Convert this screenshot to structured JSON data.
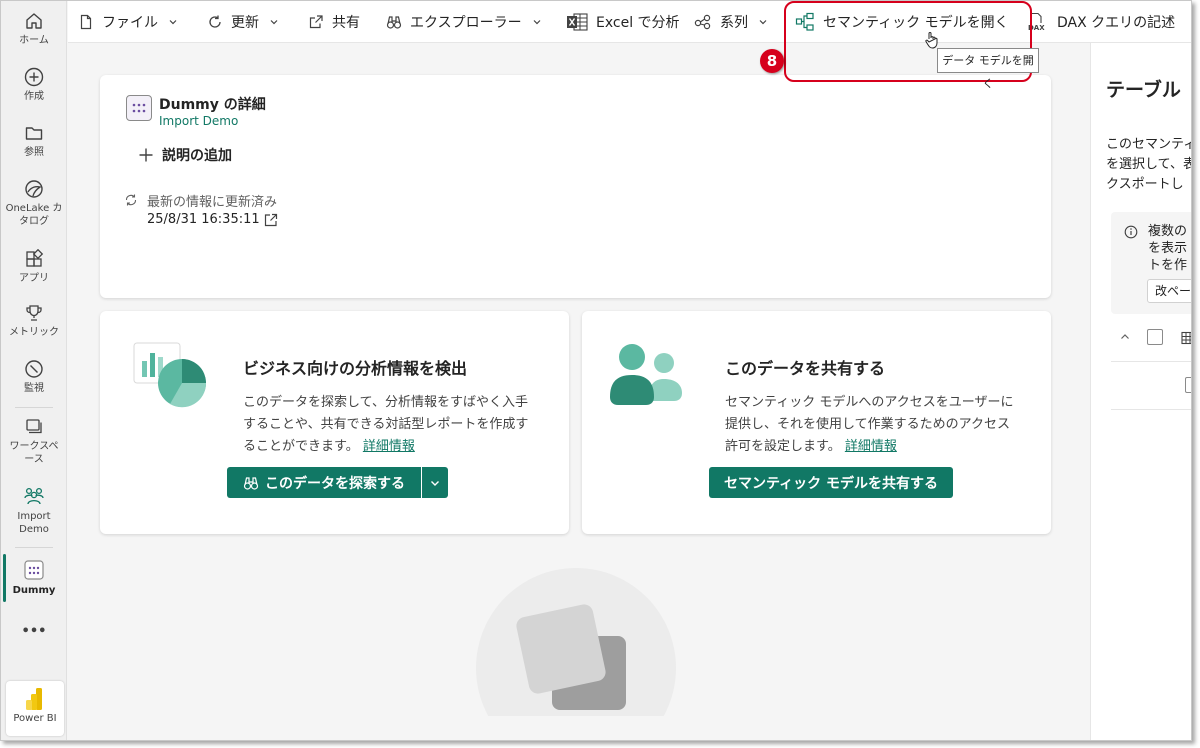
{
  "nav": {
    "home": "ホーム",
    "create": "作成",
    "browse": "参照",
    "onelake": "OneLake カタログ",
    "apps": "アプリ",
    "metrics": "メトリック",
    "monitor": "監視",
    "workspaces": "ワークスペース",
    "import_demo": "Import Demo",
    "dummy": "Dummy",
    "more": "•••",
    "powerbi": "Power BI"
  },
  "toolbar": {
    "file": "ファイル",
    "refresh": "更新",
    "share": "共有",
    "explorer": "エクスプローラー",
    "excel": "Excel で分析",
    "lineage": "系列",
    "open_model": "セマンティック モデルを開く",
    "dax": "DAX クエリの記述"
  },
  "annotation": {
    "step": "8",
    "tooltip": "データ モデルを開く"
  },
  "details": {
    "title": "Dummy の詳細",
    "workspace": "Import Demo",
    "add_description": "説明の追加",
    "refresh_status": "最新の情報に更新済み",
    "refresh_time": "25/8/31 16:35:11"
  },
  "discover": {
    "title": "ビジネス向けの分析情報を検出",
    "body": "このデータを探索して、分析情報をすばやく入手することや、共有できる対話型レポートを作成することができます。",
    "link": "詳細情報",
    "button": "このデータを探索する"
  },
  "share_card": {
    "title": "このデータを共有する",
    "body": "セマンティック モデルへのアクセスをユーザーに提供し、それを使用して作業するためのアクセス許可を設定します。",
    "link": "詳細情報",
    "button": "セマンティック モデルを共有する"
  },
  "right_panel": {
    "title": "テーブル",
    "desc1": "このセマンティ",
    "desc2": "を選択して、表",
    "desc3": "クスポートし",
    "info1": "複数の",
    "info2": "を表示",
    "info3": "トを作",
    "page_btn": "改ペー"
  },
  "colors": {
    "accent": "#117865",
    "callout": "#d6001c"
  }
}
